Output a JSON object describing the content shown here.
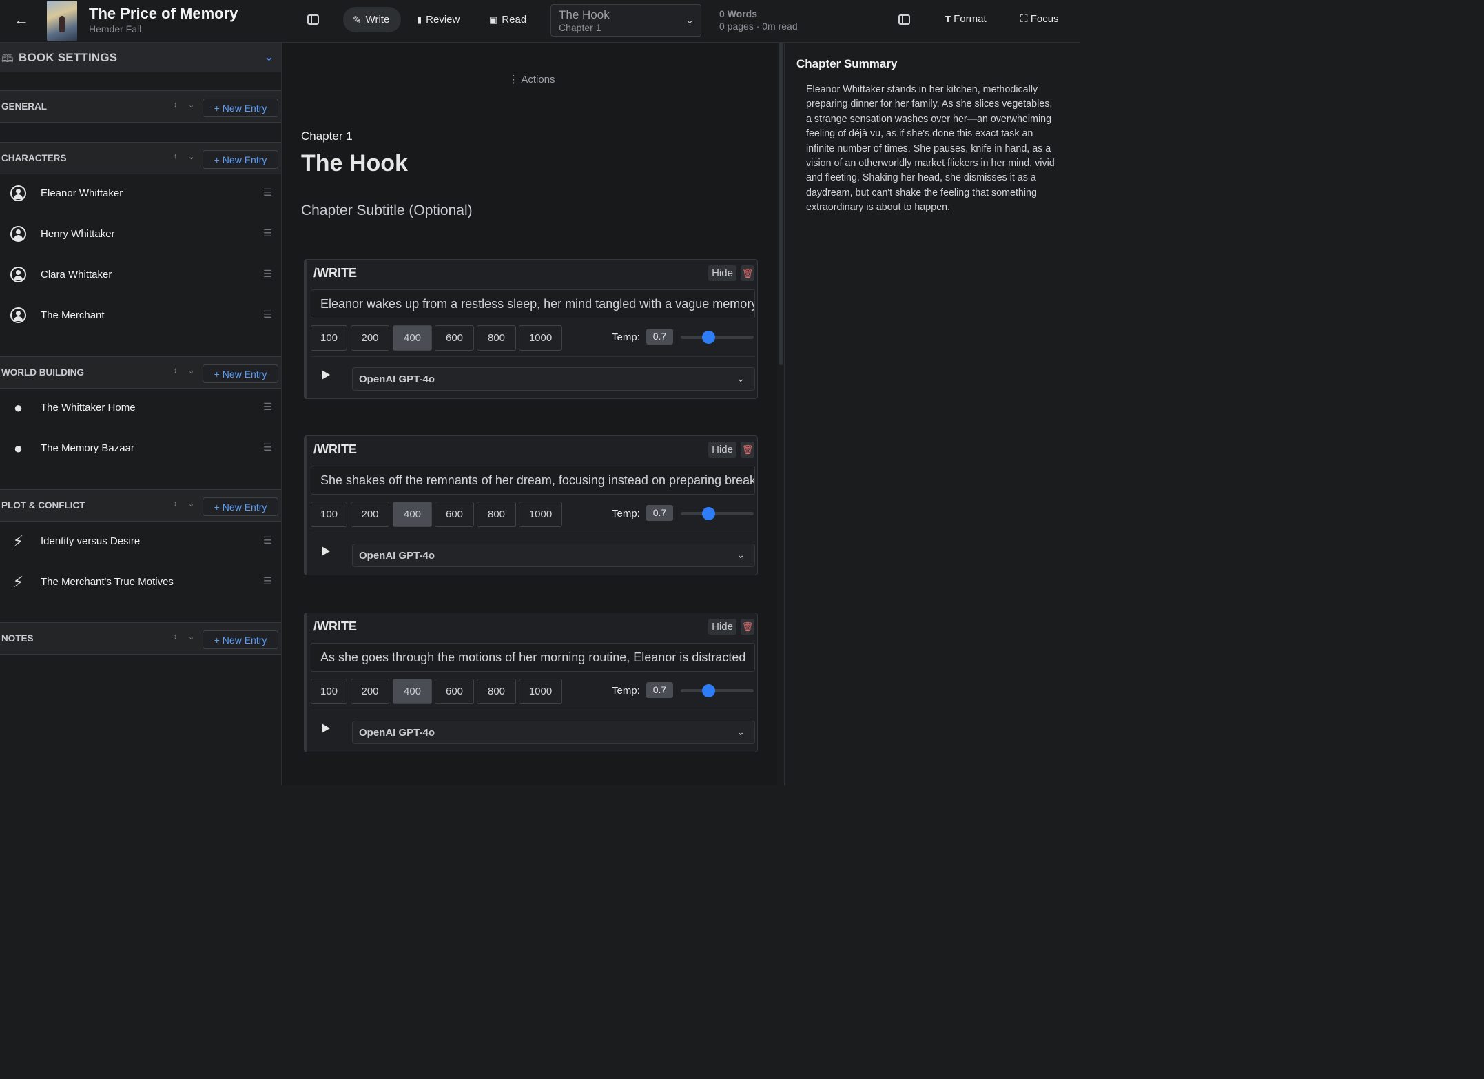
{
  "header": {
    "back_icon": "arrow-left-icon",
    "book_title": "The Price of Memory",
    "author": "Hemder Fall",
    "modes": [
      {
        "label": "Write",
        "icon": "pencil-icon",
        "active": true
      },
      {
        "label": "Review",
        "icon": "bar-chart-icon",
        "active": false
      },
      {
        "label": "Read",
        "icon": "book-open-icon",
        "active": false
      }
    ],
    "chapter_select": {
      "title": "The Hook",
      "subtitle": "Chapter 1"
    },
    "word_count": "0 Words",
    "page_info": "0 pages · 0m read",
    "format_label": "Format",
    "focus_label": "Focus"
  },
  "sidebar": {
    "book_settings_label": "BOOK SETTINGS",
    "new_entry_label": "New Entry",
    "sections": {
      "general": {
        "label": "GENERAL"
      },
      "characters": {
        "label": "CHARACTERS",
        "items": [
          "Eleanor Whittaker",
          "Henry Whittaker",
          "Clara Whittaker",
          "The Merchant"
        ]
      },
      "world_building": {
        "label": "WORLD BUILDING",
        "items": [
          "The Whittaker Home",
          "The Memory Bazaar"
        ]
      },
      "plot_conflict": {
        "label": "PLOT & CONFLICT",
        "items": [
          "Identity versus Desire",
          "The Merchant's True Motives"
        ]
      },
      "notes": {
        "label": "NOTES"
      }
    }
  },
  "editor": {
    "actions_label": "Actions",
    "chapter_number": "Chapter 1",
    "chapter_title": "The Hook",
    "chapter_subtitle_placeholder": "Chapter Subtitle (Optional)",
    "length_options": [
      "100",
      "200",
      "400",
      "600",
      "800",
      "1000"
    ],
    "selected_length": "400",
    "temp_label": "Temp:",
    "hide_label": "Hide",
    "blocks": [
      {
        "title": "/WRITE",
        "prompt": "Eleanor wakes up from a restless sleep, her mind tangled with a vague memory",
        "temp": "0.7",
        "model": "OpenAI GPT-4o"
      },
      {
        "title": "/WRITE",
        "prompt": "She shakes off the remnants of her dream, focusing instead on preparing breakfast",
        "temp": "0.7",
        "model": "OpenAI GPT-4o"
      },
      {
        "title": "/WRITE",
        "prompt": "As she goes through the motions of her morning routine, Eleanor is distracted",
        "temp": "0.7",
        "model": "OpenAI GPT-4o"
      }
    ]
  },
  "summary": {
    "title": "Chapter Summary",
    "text": "Eleanor Whittaker stands in her kitchen, methodically preparing dinner for her family. As she slices vegetables, a strange sensation washes over her—an overwhelming feeling of déjà vu, as if she's done this exact task an infinite number of times. She pauses, knife in hand, as a vision of an otherworldly market flickers in her mind, vivid and fleeting. Shaking her head, she dismisses it as a daydream, but can't shake the feeling that something extraordinary is about to happen."
  },
  "colors": {
    "accent": "#2f7df6",
    "link": "#5a9cf8",
    "danger": "#e06c6c",
    "background": "#18191b"
  }
}
